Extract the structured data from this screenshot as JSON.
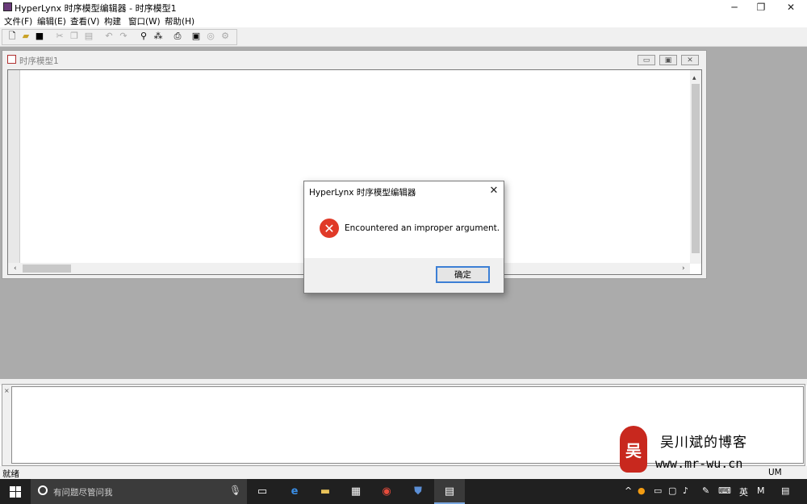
{
  "window": {
    "title": "HyperLynx 时序模型编辑器 - 时序模型1",
    "caption_minimize": "─",
    "caption_restore": "❐",
    "caption_close": "✕"
  },
  "menu": [
    {
      "label": "文件(F)"
    },
    {
      "label": "编辑(E)"
    },
    {
      "label": "查看(V)"
    },
    {
      "label": "构建"
    },
    {
      "label": "窗口(W)"
    },
    {
      "label": "帮助(H)"
    }
  ],
  "toolbar": {
    "icons": [
      "new-file-icon",
      "open-folder-icon",
      "save-icon",
      "cut-icon",
      "copy-icon",
      "paste-icon",
      "undo-icon",
      "redo-icon",
      "find-icon",
      "replace-icon",
      "print-icon",
      "properties-icon",
      "check-icon",
      "build-icon"
    ]
  },
  "child_window": {
    "title": "时序模型1"
  },
  "dialog": {
    "title": "HyperLynx 时序模型编辑器",
    "message": "Encountered an improper argument.",
    "ok_label": "确定",
    "close_glyph": "✕",
    "icon": "error-icon"
  },
  "statusbar": {
    "text": "就绪",
    "num": "UM"
  },
  "watermark": {
    "seal_text": "吴",
    "name": "吴川斌的博客",
    "url": "www.mr-wu.cn"
  },
  "taskbar": {
    "search_placeholder": "有问题尽管问我",
    "tray_lang": "英",
    "tray_ime": "M"
  },
  "colors": {
    "workspace": "#ababab",
    "error": "#e03a28",
    "accent": "#3c7fd5",
    "taskbar": "#202020"
  }
}
